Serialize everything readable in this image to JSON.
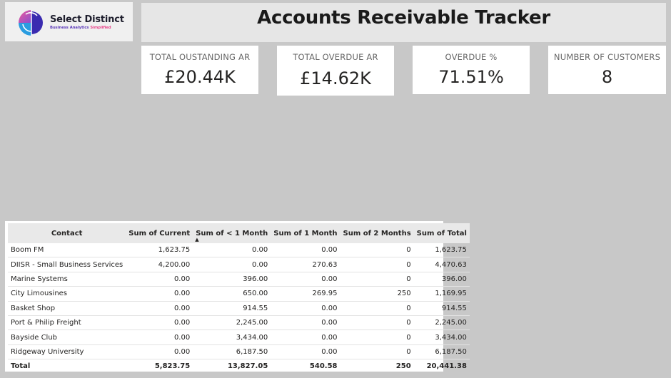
{
  "logo": {
    "name": "Select Distinct",
    "tagline_part1": "Business Analytics",
    "tagline_part2": "Simplified"
  },
  "header": {
    "title": "Accounts Receivable Tracker"
  },
  "kpis": [
    {
      "label": "TOTAL OUSTANDING AR",
      "value": "£20.44K"
    },
    {
      "label": "TOTAL OVERDUE AR",
      "value": "£14.62K"
    },
    {
      "label": "OVERDUE %",
      "value": "71.51%"
    },
    {
      "label": "NUMBER OF CUSTOMERS",
      "value": "8"
    }
  ],
  "table": {
    "columns": [
      "Contact",
      "Sum of Current",
      "Sum of < 1 Month",
      "Sum of 1 Month",
      "Sum of 2 Months",
      "Sum of Total"
    ],
    "sorted_column": "Sum of < 1 Month",
    "sort_direction": "ascending",
    "rows": [
      [
        "Boom FM",
        "1,623.75",
        "0.00",
        "0.00",
        "0",
        "1,623.75"
      ],
      [
        "DIISR - Small Business Services",
        "4,200.00",
        "0.00",
        "270.63",
        "0",
        "4,470.63"
      ],
      [
        "Marine Systems",
        "0.00",
        "396.00",
        "0.00",
        "0",
        "396.00"
      ],
      [
        "City Limousines",
        "0.00",
        "650.00",
        "269.95",
        "250",
        "1,169.95"
      ],
      [
        "Basket Shop",
        "0.00",
        "914.55",
        "0.00",
        "0",
        "914.55"
      ],
      [
        "Port & Philip Freight",
        "0.00",
        "2,245.00",
        "0.00",
        "0",
        "2,245.00"
      ],
      [
        "Bayside Club",
        "0.00",
        "3,434.00",
        "0.00",
        "0",
        "3,434.00"
      ],
      [
        "Ridgeway University",
        "0.00",
        "6,187.50",
        "0.00",
        "0",
        "6,187.50"
      ]
    ],
    "total": [
      "Total",
      "5,823.75",
      "13,827.05",
      "540.58",
      "250",
      "20,441.38"
    ]
  },
  "colors": {
    "background": "#c8c8c8",
    "card": "#ffffff",
    "logo_purple": "#5a37b8",
    "logo_pink": "#e8458b",
    "logo_blue": "#2a9de0"
  },
  "icons": {
    "logo_mark": "select-distinct-logo-icon",
    "sort": "sort-ascending-icon"
  }
}
